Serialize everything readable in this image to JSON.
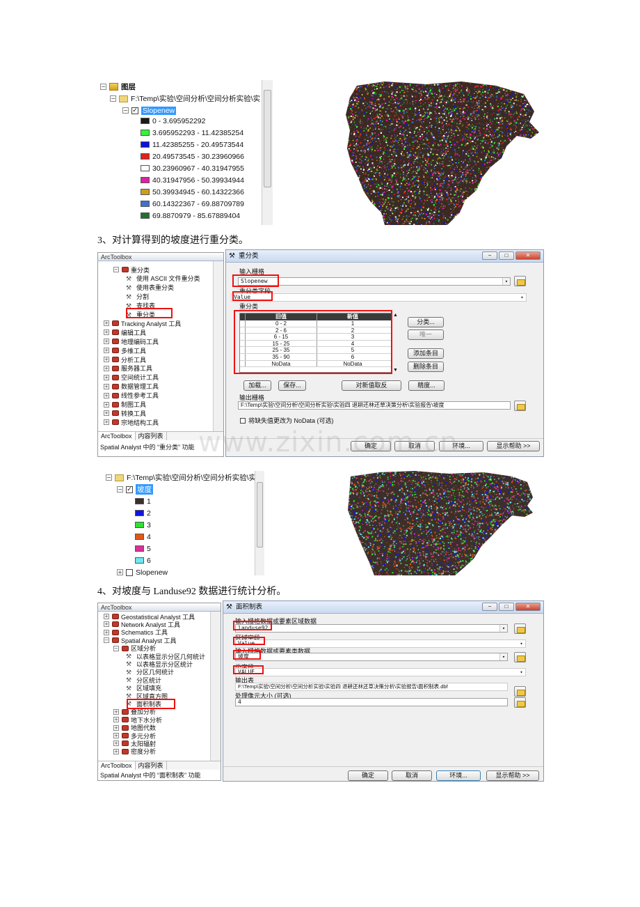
{
  "panel1": {
    "root_label": "图层",
    "path_label": "F:\\Temp\\实验\\空间分析\\空间分析实验\\实",
    "layer_name": "Slopenew",
    "legend": [
      {
        "label": "0 - 3.695952292",
        "color": "#1a1a1a"
      },
      {
        "label": "3.695952293 - 11.42385254",
        "color": "#36f336"
      },
      {
        "label": "11.42385255 - 20.49573544",
        "color": "#1010d8"
      },
      {
        "label": "20.49573545 - 30.23960966",
        "color": "#e02020"
      },
      {
        "label": "30.23960967 - 40.31947955",
        "color": "#ffffff"
      },
      {
        "label": "40.31947956 - 50.39934944",
        "color": "#e020a0"
      },
      {
        "label": "50.39934945 - 60.14322366",
        "color": "#c8a020"
      },
      {
        "label": "60.14322367 - 69.88709789",
        "color": "#4070d0"
      },
      {
        "label": "69.8870979 - 85.67889404",
        "color": "#207030"
      }
    ]
  },
  "caption3": "3、对计算得到的坡度进行重分类。",
  "toolbox1": {
    "title": "ArcToolbox",
    "items": [
      {
        "label": "重分类",
        "kind": "set"
      },
      {
        "label": "使用 ASCII 文件重分类",
        "kind": "tool"
      },
      {
        "label": "使用表重分类",
        "kind": "tool"
      },
      {
        "label": "分割",
        "kind": "tool"
      },
      {
        "label": "查找表",
        "kind": "tool"
      },
      {
        "label": "重分类",
        "kind": "tool"
      },
      {
        "label": "Tracking Analyst 工具",
        "kind": "box"
      },
      {
        "label": "编辑工具",
        "kind": "box"
      },
      {
        "label": "地理编码工具",
        "kind": "box"
      },
      {
        "label": "多维工具",
        "kind": "box"
      },
      {
        "label": "分析工具",
        "kind": "box"
      },
      {
        "label": "服务器工具",
        "kind": "box"
      },
      {
        "label": "空间统计工具",
        "kind": "box"
      },
      {
        "label": "数据管理工具",
        "kind": "box"
      },
      {
        "label": "线性参考工具",
        "kind": "box"
      },
      {
        "label": "制图工具",
        "kind": "box"
      },
      {
        "label": "转换工具",
        "kind": "box"
      },
      {
        "label": "宗地结构工具",
        "kind": "box"
      }
    ],
    "tab1": "ArcToolbox",
    "tab2": "内容列表",
    "status": "Spatial Analyst 中的 “重分类” 功能"
  },
  "dialog1": {
    "title": "重分类",
    "input_label": "输入栅格",
    "input_value": "Slopenew",
    "field_label": "重分类字段",
    "field_value": "Value",
    "reclass_label": "重分类",
    "col_old": "旧值",
    "col_new": "新值",
    "rows": [
      [
        "0 - 2",
        "1"
      ],
      [
        "2 - 6",
        "2"
      ],
      [
        "6 - 15",
        "3"
      ],
      [
        "15 - 25",
        "4"
      ],
      [
        "25 - 35",
        "5"
      ],
      [
        "35 - 90",
        "6"
      ],
      [
        "NoData",
        "NoData"
      ]
    ],
    "btn_classify": "分类...",
    "btn_unique": "唯一",
    "btn_add": "添加条目",
    "btn_delete": "删除条目",
    "btn_load": "加载...",
    "btn_save": "保存...",
    "btn_reverse": "对新值取反",
    "btn_precision": "精度...",
    "output_label": "输出栅格",
    "output_value": "F:\\Temp\\实验\\空间分析\\空间分析实验\\实验四 退耕还林还草决策分析\\实验报告\\坡度",
    "nodata_label": "将缺失值更改为 NoData (可选)",
    "btn_ok": "确定",
    "btn_cancel": "取消",
    "btn_env": "环境...",
    "btn_help": "显示帮助 >>"
  },
  "watermark": "www.zixin.com.cn",
  "panel2": {
    "path_label": "F:\\Temp\\实验\\空间分析\\空间分析实验\\实",
    "layer_name": "坡度",
    "legend": [
      {
        "label": "1",
        "color": "#3a302a"
      },
      {
        "label": "2",
        "color": "#1414e0"
      },
      {
        "label": "3",
        "color": "#30e030"
      },
      {
        "label": "4",
        "color": "#e05818"
      },
      {
        "label": "5",
        "color": "#d83098"
      },
      {
        "label": "6",
        "color": "#70e8f0"
      }
    ],
    "other_layer": "Slopenew"
  },
  "caption4": "4、对坡度与 Landuse92 数据进行统计分析。",
  "toolbox2": {
    "title": "ArcToolbox",
    "items": [
      {
        "label": "Geostatistical Analyst 工具",
        "kind": "box",
        "indent": 0
      },
      {
        "label": "Network Analyst 工具",
        "kind": "box",
        "indent": 0
      },
      {
        "label": "Schematics 工具",
        "kind": "box",
        "indent": 0
      },
      {
        "label": "Spatial Analyst 工具",
        "kind": "box",
        "indent": 0
      },
      {
        "label": "区域分析",
        "kind": "set",
        "indent": 1
      },
      {
        "label": "以表格显示分区几何统计",
        "kind": "tool",
        "indent": 2
      },
      {
        "label": "以表格显示分区统计",
        "kind": "tool",
        "indent": 2
      },
      {
        "label": "分区几何统计",
        "kind": "tool",
        "indent": 2
      },
      {
        "label": "分区统计",
        "kind": "tool",
        "indent": 2
      },
      {
        "label": "区域填充",
        "kind": "tool",
        "indent": 2
      },
      {
        "label": "区域直方图",
        "kind": "tool",
        "indent": 2
      },
      {
        "label": "面积制表",
        "kind": "tool",
        "indent": 2
      },
      {
        "label": "叠加分析",
        "kind": "set",
        "indent": 1
      },
      {
        "label": "地下水分析",
        "kind": "set",
        "indent": 1
      },
      {
        "label": "地图代数",
        "kind": "set",
        "indent": 1
      },
      {
        "label": "多元分析",
        "kind": "set",
        "indent": 1
      },
      {
        "label": "太阳辐射",
        "kind": "set",
        "indent": 1
      },
      {
        "label": "密度分析",
        "kind": "set",
        "indent": 1
      }
    ],
    "tab1": "ArcToolbox",
    "tab2": "内容列表",
    "status": "Spatial Analyst 中的 “面积制表” 功能"
  },
  "dialog2": {
    "title": "面积制表",
    "zone_label": "输入栅格数据或要素区域数据",
    "zone_value": "landuse92",
    "zone_field_label": "区域字段",
    "zone_field_value": "Value",
    "class_label": "输入栅格数据或要素类数据",
    "class_value": "坡度",
    "class_field_label": "类字段",
    "class_field_value": "VALUE",
    "out_label": "输出表",
    "out_value": "F:\\Temp\\实验\\空间分析\\空间分析实验\\实验四 退耕还林还草决策分析\\实验报告\\面积制表.dbf",
    "cell_label": "处理像元大小 (可选)",
    "cell_value": "4",
    "btn_ok": "确定",
    "btn_cancel": "取消",
    "btn_env": "环境...",
    "btn_help": "显示帮助 >>"
  }
}
